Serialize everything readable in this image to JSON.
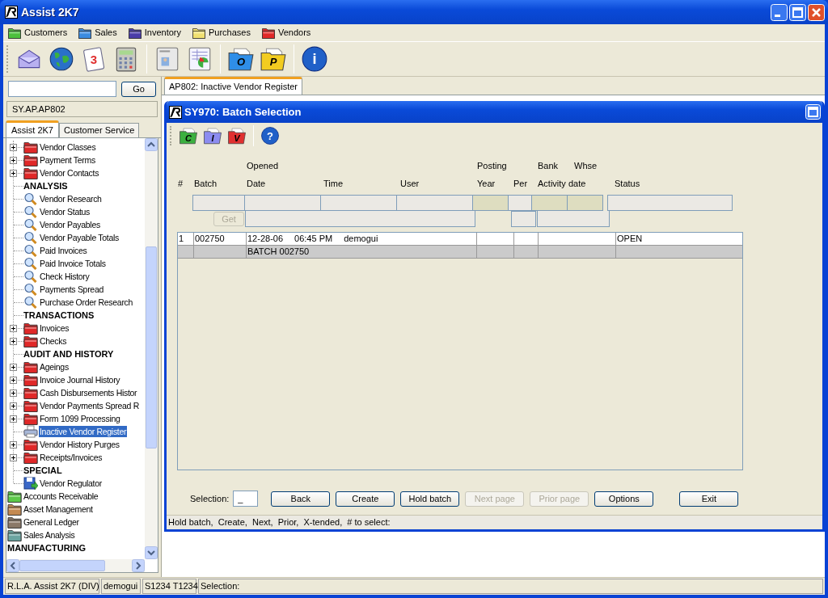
{
  "window": {
    "title": "Assist 2K7"
  },
  "menu": [
    {
      "label": "Customers",
      "color": "#4cc03c"
    },
    {
      "label": "Sales",
      "color": "#3c8ce0"
    },
    {
      "label": "Inventory",
      "color": "#4a3ca8"
    },
    {
      "label": "Purchases",
      "color": "#f0e070"
    },
    {
      "label": "Vendors",
      "color": "#e02828"
    }
  ],
  "toolbar_groups": [
    [
      {
        "kind": "envelope"
      },
      {
        "kind": "globe"
      },
      {
        "kind": "calendar",
        "label": "3"
      },
      {
        "kind": "calculator"
      }
    ],
    [
      {
        "kind": "card"
      },
      {
        "kind": "sheet"
      }
    ],
    [
      {
        "kind": "folder",
        "label": "O",
        "color": "#2f8ee8"
      },
      {
        "kind": "folder",
        "label": "P",
        "color": "#f2cc20"
      }
    ],
    [
      {
        "kind": "info",
        "label": "i"
      }
    ]
  ],
  "sidebar": {
    "search": {
      "button": "Go"
    },
    "path": "SY.AP.AP802",
    "tabs": [
      {
        "label": "Assist 2K7",
        "selected": true
      },
      {
        "label": "Customer Service",
        "selected": false
      }
    ],
    "tree": [
      {
        "children": [
          {
            "label": "Vendor Classes",
            "kind": "folder",
            "expandable": true,
            "selected": false
          },
          {
            "label": "Payment Terms",
            "kind": "folder",
            "expandable": true,
            "selected": false
          },
          {
            "label": "Vendor Contacts",
            "kind": "folder",
            "expandable": true,
            "selected": false
          },
          {
            "label": "ANALYSIS",
            "kind": "section"
          },
          {
            "label": "Vendor Research",
            "kind": "search",
            "selected": false
          },
          {
            "label": "Vendor Status",
            "kind": "search",
            "selected": false
          },
          {
            "label": "Vendor Payables",
            "kind": "search",
            "selected": false
          },
          {
            "label": "Vendor Payable Totals",
            "kind": "search",
            "selected": false
          },
          {
            "label": "Paid Invoices",
            "kind": "search",
            "selected": false
          },
          {
            "label": "Paid Invoice Totals",
            "kind": "search",
            "selected": false
          },
          {
            "label": "Check History",
            "kind": "search",
            "selected": false
          },
          {
            "label": "Payments Spread",
            "kind": "search",
            "selected": false
          },
          {
            "label": "Purchase Order Research",
            "kind": "search",
            "selected": false
          },
          {
            "label": "TRANSACTIONS",
            "kind": "section"
          },
          {
            "label": "Invoices",
            "kind": "folder",
            "expandable": true,
            "selected": false
          },
          {
            "label": "Checks",
            "kind": "folder",
            "expandable": true,
            "selected": false
          },
          {
            "label": "AUDIT AND HISTORY",
            "kind": "section"
          },
          {
            "label": "Ageings",
            "kind": "folder",
            "expandable": true,
            "selected": false
          },
          {
            "label": "Invoice Journal History",
            "kind": "folder",
            "expandable": true,
            "selected": false
          },
          {
            "label": "Cash Disbursements Histor",
            "kind": "folder",
            "expandable": true,
            "selected": false
          },
          {
            "label": "Vendor Payments Spread R",
            "kind": "folder",
            "expandable": true,
            "selected": false
          },
          {
            "label": "Form 1099 Processing",
            "kind": "folder",
            "expandable": true,
            "selected": false
          },
          {
            "label": "Inactive Vendor Register",
            "kind": "print",
            "selected": true
          },
          {
            "label": "Vendor History Purges",
            "kind": "folder",
            "expandable": true,
            "selected": false
          },
          {
            "label": "Receipts/Invoices",
            "kind": "folder",
            "expandable": true,
            "selected": false
          },
          {
            "label": "SPECIAL",
            "kind": "section"
          },
          {
            "label": "Vendor Regulator",
            "kind": "disk",
            "selected": false
          }
        ]
      },
      {
        "label": "Accounts Receivable",
        "kind": "module",
        "color": "#5cc84a",
        "selected": false
      },
      {
        "label": "Asset Management",
        "kind": "module",
        "color": "#c48a52",
        "selected": false
      },
      {
        "label": "General Ledger",
        "kind": "module",
        "color": "#8a7868",
        "selected": false
      },
      {
        "label": "Sales Analysis",
        "kind": "module",
        "color": "#6aa4a0",
        "selected": false
      },
      {
        "label": "MANUFACTURING",
        "kind": "section"
      }
    ]
  },
  "doc_tabs": [
    {
      "label": "AP802: Inactive Vendor Register",
      "selected": true
    }
  ],
  "dialog": {
    "title": "SY970: Batch Selection",
    "toolbar_groups": [
      [
        {
          "kind": "folder",
          "label": "C",
          "color": "#3cb040"
        },
        {
          "kind": "folder",
          "label": "I",
          "color": "#8c8cf0"
        },
        {
          "kind": "folder",
          "label": "V",
          "color": "#e03030"
        }
      ],
      [
        {
          "kind": "help",
          "label": "?"
        }
      ]
    ],
    "columns": [
      {
        "label": "#"
      },
      {
        "label": "Batch"
      },
      {
        "top": "Opened",
        "label": "Date"
      },
      {
        "label": "Time"
      },
      {
        "label": "User"
      },
      {
        "top": "Posting",
        "label": "Year"
      },
      {
        "label": "Per"
      },
      {
        "top": "Bank",
        "label": "Activity date"
      },
      {
        "top": "Whse"
      },
      {
        "label": "Status"
      }
    ],
    "get_button": {
      "label": "Get",
      "disabled": true
    },
    "rows": [
      {
        "kind": "batch",
        "number": "1",
        "batch": "002750",
        "date": "12-28-06",
        "time": "06:45 PM",
        "user": "demogui",
        "status": "OPEN"
      },
      {
        "kind": "detail",
        "description": "BATCH 002750"
      }
    ],
    "selection": {
      "label": "Selection:",
      "value": "_"
    },
    "buttons": [
      {
        "label": "Back",
        "disabled": false
      },
      {
        "label": "Create",
        "disabled": false
      },
      {
        "label": "Hold batch",
        "disabled": false
      },
      {
        "label": "Next page",
        "disabled": true
      },
      {
        "label": "Prior page",
        "disabled": true
      },
      {
        "label": "Options",
        "disabled": false
      },
      {
        "label": "Exit",
        "disabled": false
      }
    ],
    "hint": "Hold batch,  Create,  Next,  Prior,  X-tended,  # to select:"
  },
  "status_bar": [
    "R.L.A. Assist 2K7 (DIV)",
    "demogui",
    "S1234 T1234",
    "Selection:"
  ]
}
